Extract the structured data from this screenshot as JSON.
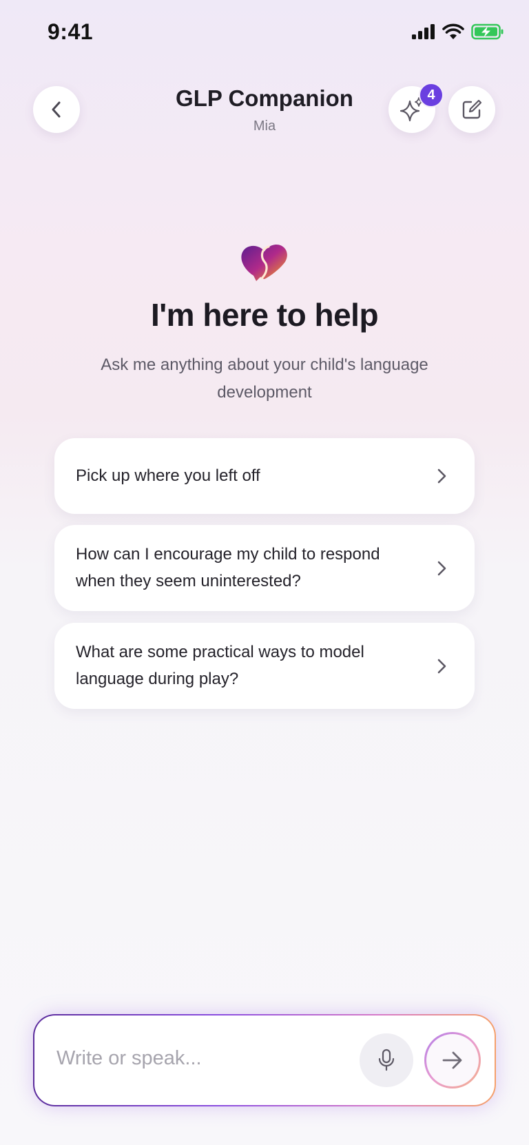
{
  "status_bar": {
    "time": "9:41"
  },
  "header": {
    "title": "GLP Companion",
    "subtitle": "Mia",
    "sparkle_badge_count": "4",
    "icons": {
      "back": "chevron-left-icon",
      "sparkle": "sparkles-icon",
      "compose": "compose-icon"
    }
  },
  "hero": {
    "title": "I'm here to help",
    "subtitle": "Ask me anything about your child's language development",
    "logo_icon": "heart-chat-logo"
  },
  "suggestions": [
    {
      "label": "Pick up where you left off"
    },
    {
      "label": "How can I encourage my child to respond when they seem uninterested?"
    },
    {
      "label": "What are some practical ways to model language during play?"
    }
  ],
  "composer": {
    "placeholder": "Write or speak...",
    "value": "",
    "mic_icon": "microphone-icon",
    "send_icon": "arrow-right-icon"
  },
  "colors": {
    "accent": "#6a3fe0",
    "gradient_start": "#5b2c9c",
    "gradient_end": "#f5a06a",
    "battery": "#34c759"
  }
}
